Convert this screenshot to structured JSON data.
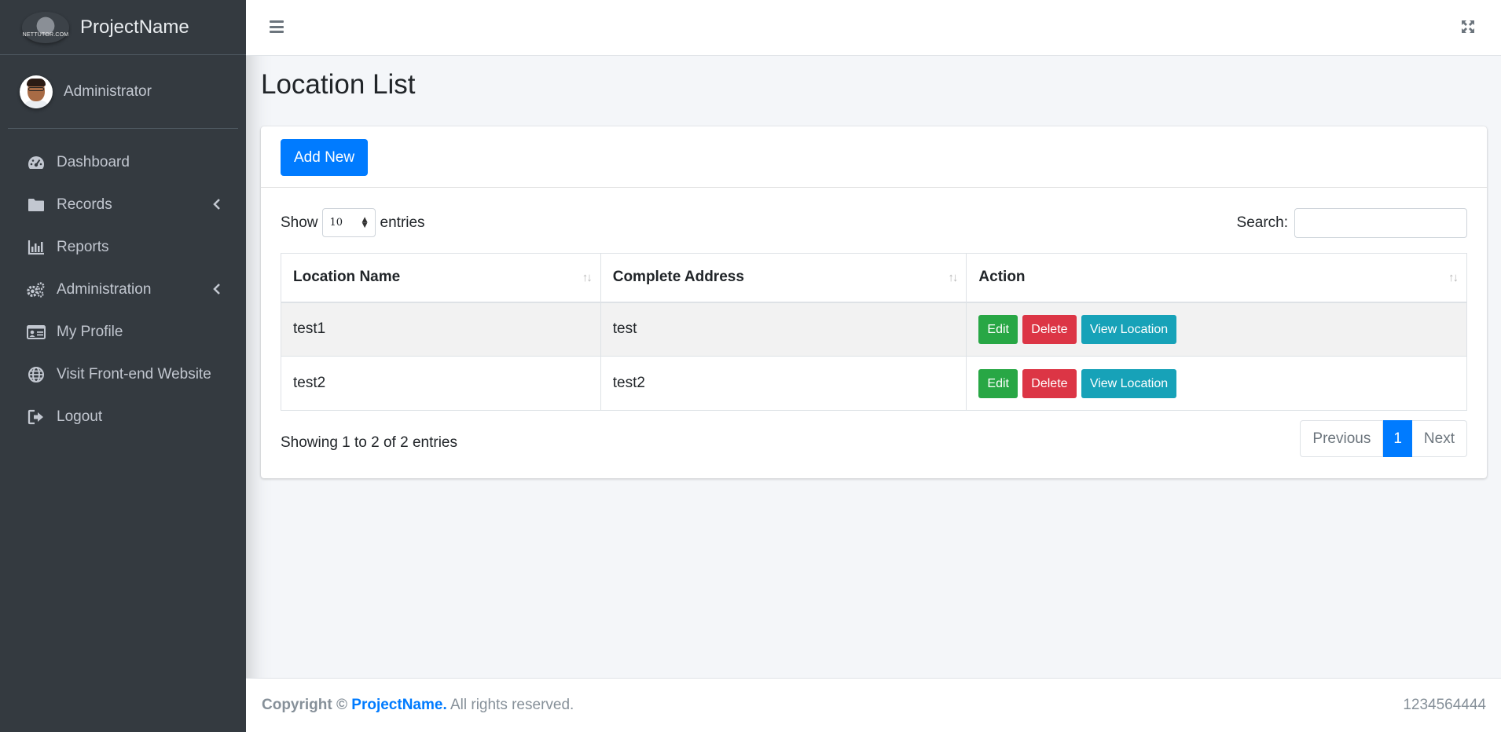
{
  "brand": {
    "name": "ProjectName",
    "logo_text": "NETTUTOR.COM"
  },
  "user": {
    "name": "Administrator"
  },
  "sidebar": {
    "items": [
      {
        "label": "Dashboard",
        "icon": "tachometer-icon",
        "has_children": false
      },
      {
        "label": "Records",
        "icon": "folder-icon",
        "has_children": true
      },
      {
        "label": "Reports",
        "icon": "bar-chart-icon",
        "has_children": false
      },
      {
        "label": "Administration",
        "icon": "cogs-icon",
        "has_children": true
      },
      {
        "label": "My Profile",
        "icon": "id-card-icon",
        "has_children": false
      },
      {
        "label": "Visit Front-end Website",
        "icon": "globe-icon",
        "has_children": false
      },
      {
        "label": "Logout",
        "icon": "sign-out-icon",
        "has_children": false
      }
    ]
  },
  "topbar": {
    "menu_icon": "hamburger-icon",
    "fullscreen_icon": "expand-icon"
  },
  "page": {
    "title": "Location List"
  },
  "card": {
    "add_label": "Add New"
  },
  "table_controls": {
    "show_label": "Show",
    "entries_label": "entries",
    "page_length": "10",
    "search_label": "Search:",
    "search_value": ""
  },
  "table": {
    "headers": [
      "Location Name",
      "Complete Address",
      "Action"
    ],
    "rows": [
      {
        "location_name": "test1",
        "complete_address": "test"
      },
      {
        "location_name": "test2",
        "complete_address": "test2"
      }
    ],
    "actions": {
      "edit": "Edit",
      "delete": "Delete",
      "view": "View Location"
    }
  },
  "pagination": {
    "info": "Showing 1 to 2 of 2 entries",
    "previous": "Previous",
    "current": "1",
    "next": "Next"
  },
  "footer": {
    "copyright_prefix": "Copyright ©",
    "project_link": "ProjectName.",
    "rights": "All rights reserved.",
    "phone": "1234564444"
  },
  "colors": {
    "sidebar_bg": "#343a40",
    "primary": "#007bff",
    "success": "#28a745",
    "danger": "#dc3545",
    "info": "#17a2b8",
    "content_bg": "#f4f6f9"
  }
}
